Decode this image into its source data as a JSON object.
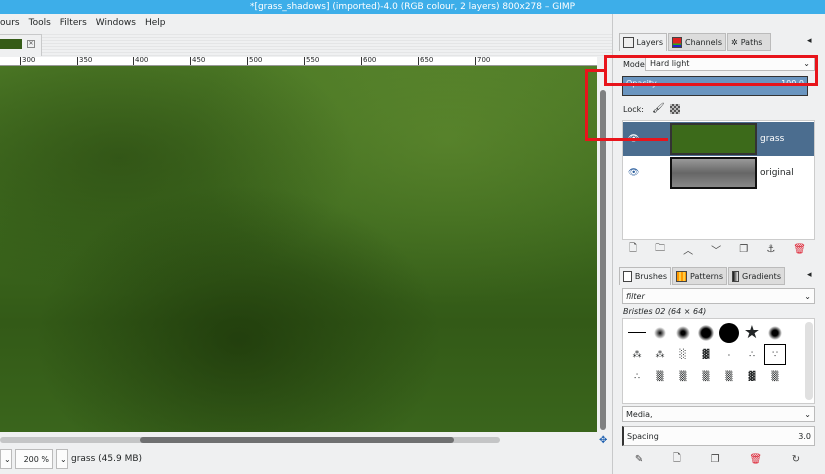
{
  "window": {
    "title": "*[grass_shadows] (imported)-4.0 (RGB colour, 2 layers) 800x278 – GIMP"
  },
  "menu": [
    "ours",
    "Tools",
    "Filters",
    "Windows",
    "Help"
  ],
  "ruler": [
    "300",
    "350",
    "400",
    "450",
    "500",
    "550",
    "600",
    "650",
    "700"
  ],
  "status": {
    "zoom": "200 %",
    "layer_info": "grass (45.9 MB)"
  },
  "layers_dock": {
    "tabs": [
      "Layers",
      "Channels",
      "Paths"
    ],
    "mode_label": "Mode:",
    "mode_value": "Hard light",
    "opacity_label": "Opacity",
    "opacity_value": "100.0",
    "lock_label": "Lock:",
    "layers": [
      {
        "name": "grass",
        "selected": true
      },
      {
        "name": "original",
        "selected": false
      }
    ]
  },
  "brushes_dock": {
    "tabs": [
      "Brushes",
      "Patterns",
      "Gradients"
    ],
    "filter_placeholder": "filter",
    "selected_brush": "Bristles 02 (64 × 64)",
    "tag": "Media,",
    "spacing_label": "Spacing",
    "spacing_value": "3.0"
  },
  "colors": {
    "accent": "#3daee9",
    "selection": "#4b6d8f",
    "annotation": "#e8141b"
  }
}
